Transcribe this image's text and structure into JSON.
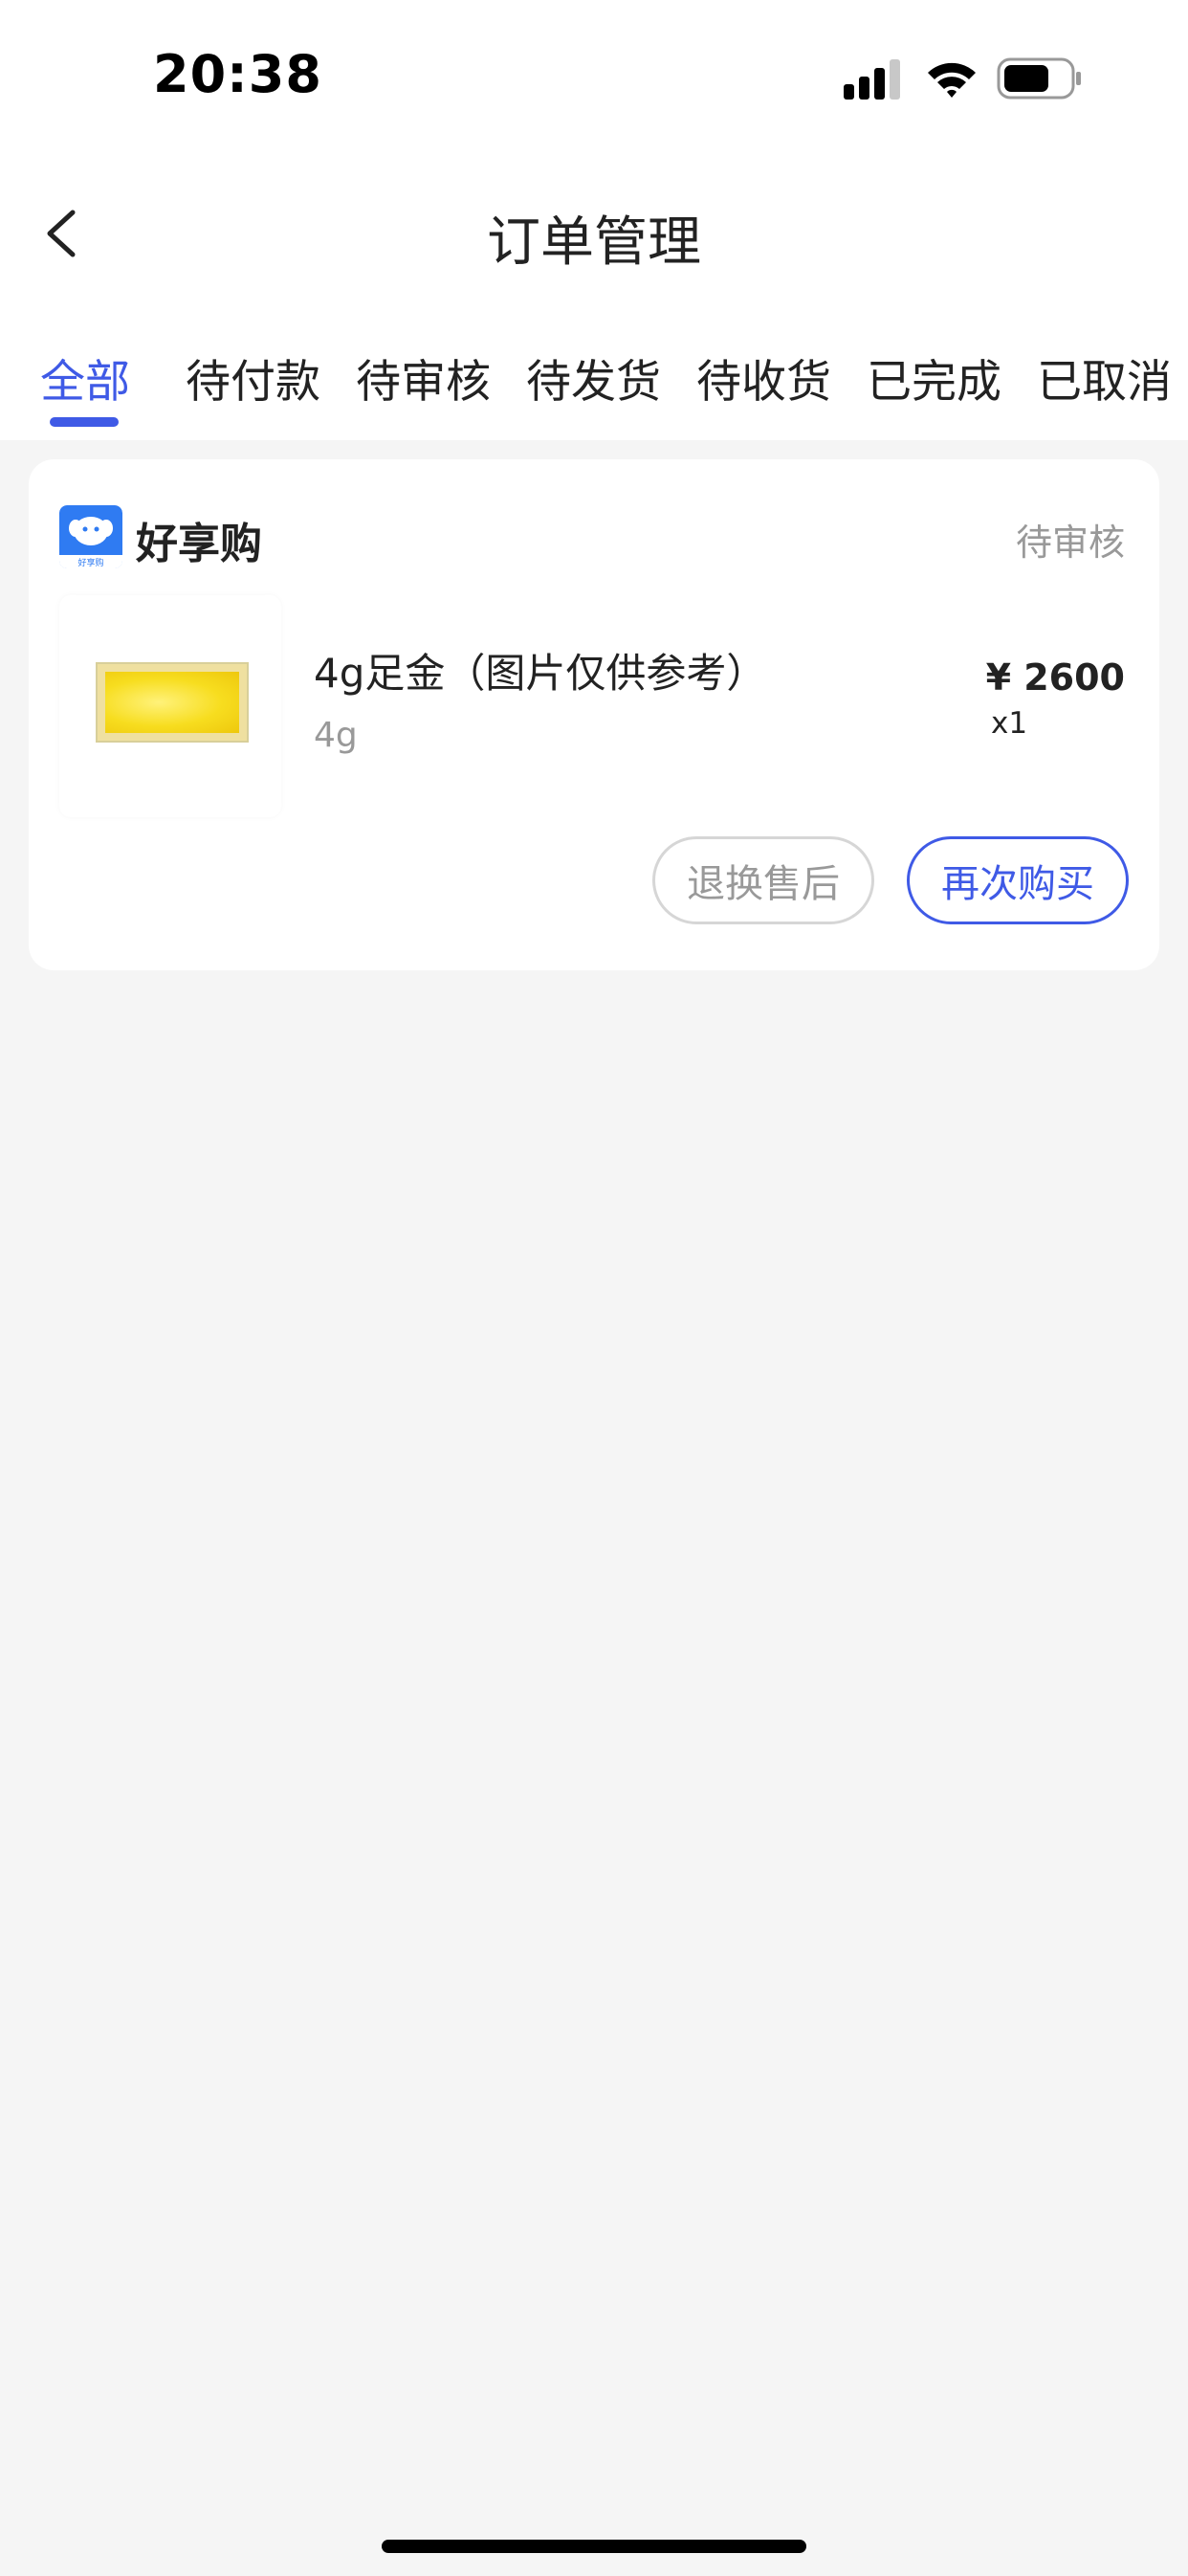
{
  "status_bar": {
    "time": "20:38"
  },
  "header": {
    "title": "订单管理",
    "back_icon": "chevron-left-icon"
  },
  "tabs": {
    "active_index": 0,
    "items": [
      {
        "label": "全部"
      },
      {
        "label": "待付款"
      },
      {
        "label": "待审核"
      },
      {
        "label": "待发货"
      },
      {
        "label": "待收货"
      },
      {
        "label": "已完成"
      },
      {
        "label": "已取消"
      }
    ]
  },
  "order": {
    "shop_name": "好享购",
    "shop_logo_text": "好享购",
    "status": "待审核",
    "product": {
      "name": "4g足金（图片仅供参考）",
      "spec": "4g",
      "price": "¥ 2600",
      "quantity": "x1"
    },
    "buttons": {
      "aftersale": "退换售后",
      "rebuy": "再次购买"
    }
  },
  "colors": {
    "accent": "#3f5ae6",
    "page_background": "#f5f5f5",
    "muted_text": "#999999"
  }
}
